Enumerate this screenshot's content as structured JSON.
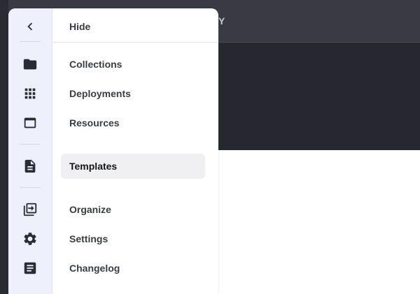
{
  "background": {
    "topbar_partial_text": "Y"
  },
  "panel": {
    "header": {
      "hide_label": "Hide"
    },
    "rail_icons": [
      "chevron-left-icon",
      "folder-icon",
      "apps-grid-icon",
      "window-icon",
      "document-icon",
      "deploy-icon",
      "gear-icon",
      "notes-icon"
    ],
    "menu_items": [
      {
        "label": "Collections"
      },
      {
        "label": "Deployments"
      },
      {
        "label": "Resources"
      },
      {
        "label": "Templates",
        "active": true
      },
      {
        "label": "Organize"
      },
      {
        "label": "Settings"
      },
      {
        "label": "Changelog"
      }
    ]
  },
  "colors": {
    "rail_background": "#eef1fb",
    "active_item_background": "#f0f0f2",
    "app_topbar": "#3a3a45",
    "app_dark_panel": "#272730"
  }
}
